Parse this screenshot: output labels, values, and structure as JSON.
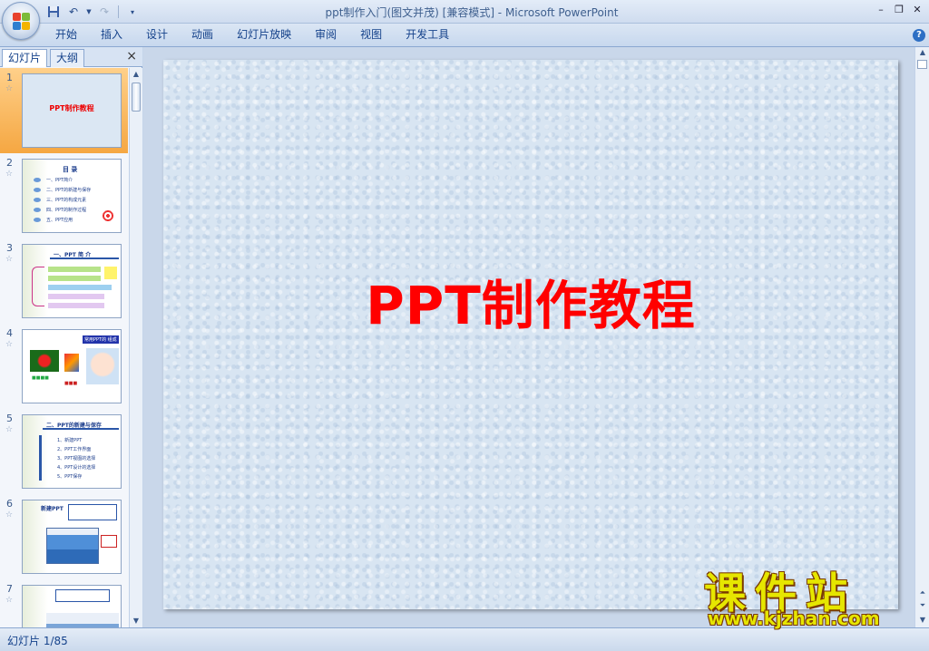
{
  "window": {
    "title": "ppt制作入门(图文并茂) [兼容模式] - Microsoft PowerPoint",
    "controls": [
      "minimize",
      "restore",
      "close"
    ]
  },
  "qat": {
    "items": [
      "save-icon",
      "undo-icon",
      "redo-icon",
      "customize-icon"
    ]
  },
  "ribbon": {
    "tabs": [
      "开始",
      "插入",
      "设计",
      "动画",
      "幻灯片放映",
      "审阅",
      "视图",
      "开发工具"
    ]
  },
  "pane": {
    "tab_slides": "幻灯片",
    "tab_outline": "大纲",
    "close": "×"
  },
  "thumbnails": [
    {
      "num": "1",
      "title": "PPT制作教程",
      "selected": true
    },
    {
      "num": "2",
      "title": "目 录",
      "lines": [
        "一、PPT简介",
        "二、PPT的新建与保存",
        "三、PPT的构成元素",
        "四、PPT的制作过程",
        "五、PPT应用"
      ]
    },
    {
      "num": "3",
      "title": "一、PPT 简 介"
    },
    {
      "num": "4",
      "title": "常用PPT的 组成"
    },
    {
      "num": "5",
      "title": "二、PPT的新建与保存",
      "lines": [
        "1、新建PPT",
        "2、PPT工作界面",
        "3、PPT视图的选择",
        "4、PPT设计的选择",
        "5、PPT保存"
      ]
    },
    {
      "num": "6",
      "title": "新建PPT"
    },
    {
      "num": "7",
      "title": ""
    }
  ],
  "slide": {
    "title": "PPT制作教程"
  },
  "status": {
    "slide_info": "幻灯片 1/85"
  },
  "watermark": {
    "cn": "课件站",
    "url": "www.kjzhan.com"
  },
  "colors": {
    "slide_title": "#ff0000",
    "selected_thumb": "#f5a742",
    "ribbon_text": "#15428b"
  }
}
